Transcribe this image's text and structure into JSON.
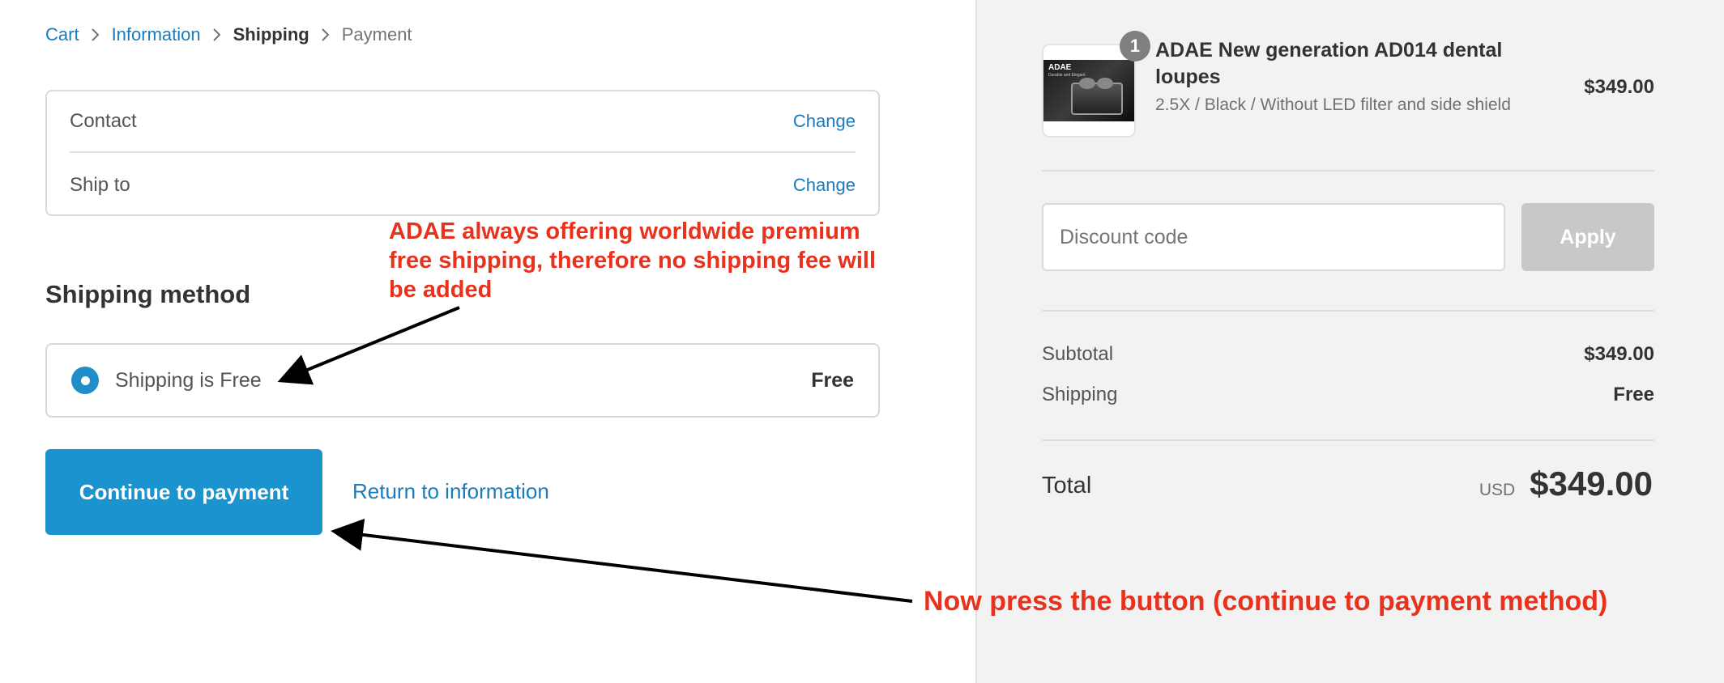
{
  "breadcrumb": {
    "items": [
      {
        "label": "Cart"
      },
      {
        "label": "Information"
      },
      {
        "label": "Shipping"
      },
      {
        "label": "Payment"
      }
    ]
  },
  "review": {
    "contact_label": "Contact",
    "ship_to_label": "Ship to",
    "change_label": "Change"
  },
  "shipping_method": {
    "title": "Shipping method",
    "option_label": "Shipping is Free",
    "option_price": "Free"
  },
  "actions": {
    "continue_label": "Continue to payment",
    "return_label": "Return to information"
  },
  "annotations": {
    "note1": "ADAE always offering worldwide premium free shipping, therefore no shipping fee will be added",
    "note2": "Now press the button (continue to payment method)"
  },
  "product": {
    "quantity": "1",
    "name": "ADAE New generation AD014 dental loupes",
    "variant": "2.5X / Black / Without LED filter and side shield",
    "price": "$349.00",
    "thumb_brand": "ADAE",
    "thumb_sub": "Durable and Elegant"
  },
  "discount": {
    "placeholder": "Discount code",
    "apply_label": "Apply"
  },
  "summary": {
    "subtotal_label": "Subtotal",
    "subtotal_value": "$349.00",
    "shipping_label": "Shipping",
    "shipping_value": "Free",
    "total_label": "Total",
    "currency": "USD",
    "total_value": "$349.00"
  },
  "colors": {
    "accent": "#1b93ce",
    "link": "#197bbd",
    "annotation": "#e8321e",
    "sidebar_bg": "#f2f2f2"
  }
}
